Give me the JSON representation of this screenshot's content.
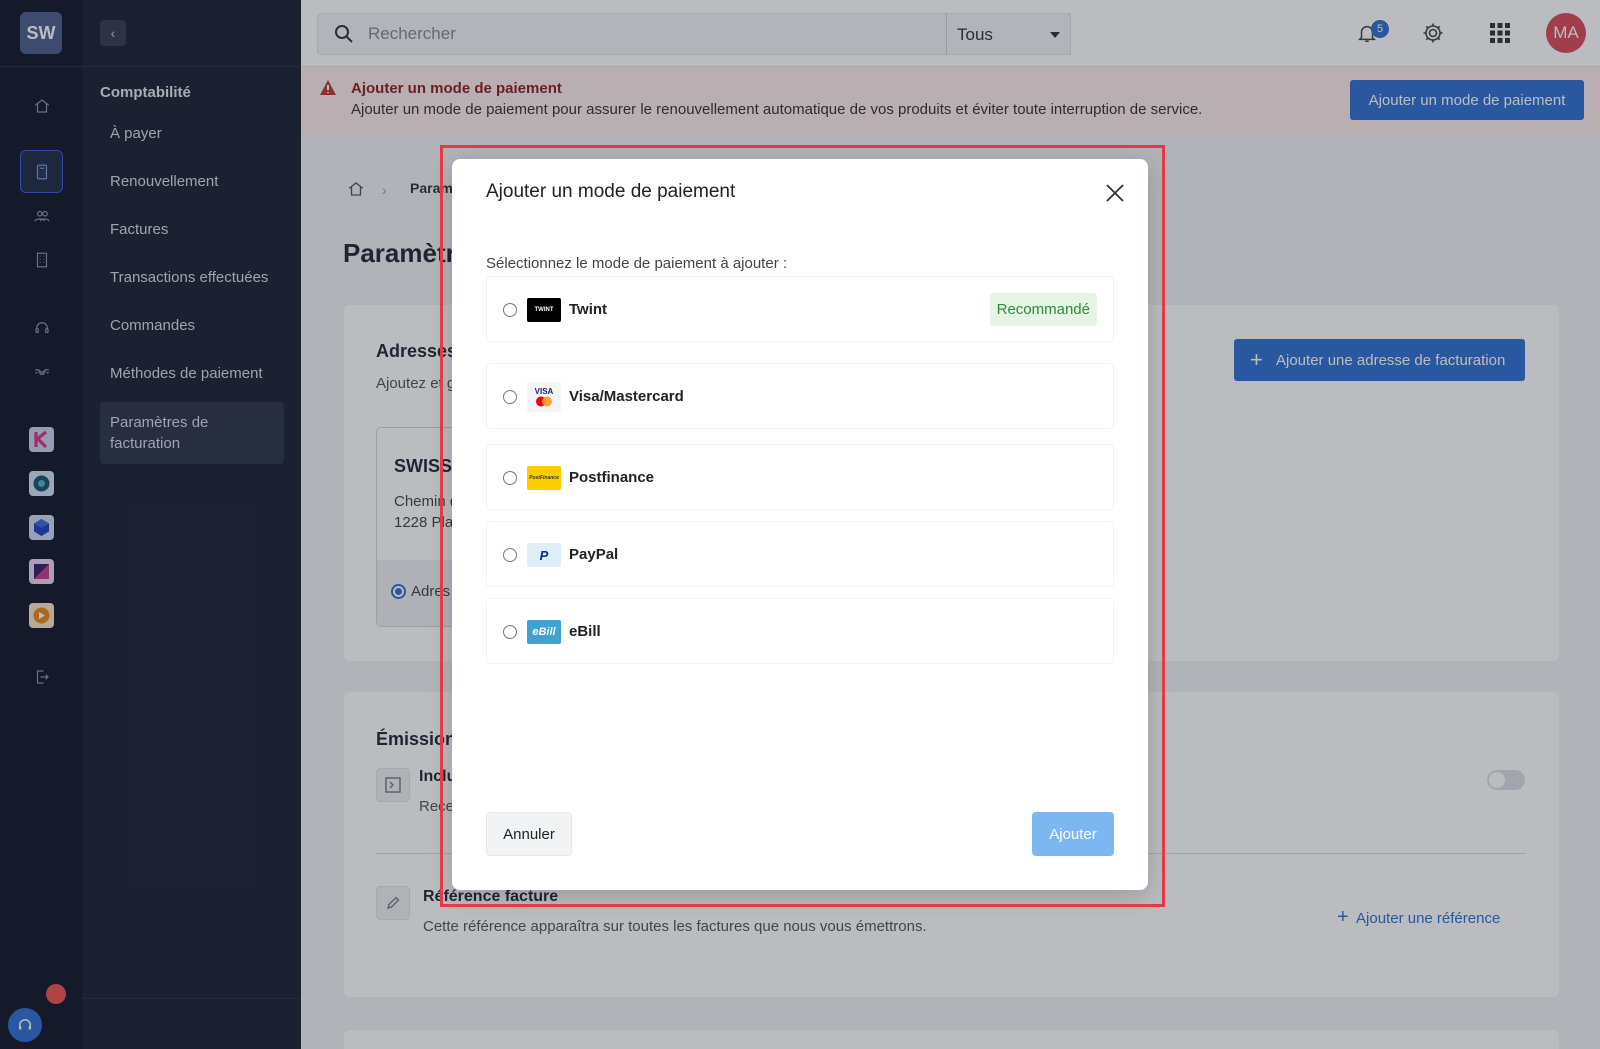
{
  "app": {
    "logo_text": "SW"
  },
  "rail": {
    "icons": [
      "home-icon",
      "calculator-icon",
      "users-icon",
      "building-icon",
      "headset-icon",
      "handshake-icon"
    ],
    "apps": [
      "app-k",
      "app-swirl",
      "app-cube",
      "app-square",
      "app-orange"
    ],
    "logout_icon": "logout-icon"
  },
  "subnav": {
    "collapse_glyph": "‹",
    "section": "Comptabilité",
    "items": [
      {
        "label": "À payer"
      },
      {
        "label": "Renouvellement"
      },
      {
        "label": "Factures"
      },
      {
        "label": "Transactions effectuées"
      },
      {
        "label": "Commandes"
      },
      {
        "label": "Méthodes de paiement"
      },
      {
        "label": "Paramètres de facturation"
      }
    ]
  },
  "topbar": {
    "search_placeholder": "Rechercher",
    "scope": "Tous",
    "notification_count": "5",
    "avatar": "MA"
  },
  "alert": {
    "title": "Ajouter un mode de paiement",
    "message": "Ajouter un mode de paiement pour assurer le renouvellement automatique de vos produits et éviter toute interruption de service.",
    "button": "Ajouter un mode de paiement"
  },
  "page": {
    "breadcrumb_current": "Paramètres",
    "title": "Paramètres",
    "address_section": {
      "title": "Adresses",
      "subtitle": "Ajoutez et gérez",
      "card_name": "SWISS",
      "card_line1": "Chemin d",
      "card_line2": "1228 Pla",
      "card_radio_label": "Adres",
      "add_button": "Ajouter une adresse de facturation"
    },
    "emission_section": {
      "title": "Émission",
      "include_title": "Inclu",
      "include_sub": "Rece",
      "reference_title": "Référence facture",
      "reference_sub": "Cette référence apparaîtra sur toutes les factures que nous vous émettrons.",
      "add_reference": "Ajouter une référence"
    }
  },
  "modal": {
    "title": "Ajouter un mode de paiement",
    "subtitle": "Sélectionnez le mode de paiement à ajouter :",
    "options": [
      {
        "label": "Twint",
        "logo_text": "TWINT",
        "badge": "Recommandé"
      },
      {
        "label": "Visa/Mastercard",
        "logo_text": "VISA"
      },
      {
        "label": "Postfinance",
        "logo_text": "PostFinance"
      },
      {
        "label": "PayPal",
        "logo_text": "P"
      },
      {
        "label": "eBill",
        "logo_text": "eBill"
      }
    ],
    "cancel": "Annuler",
    "submit": "Ajouter"
  },
  "colors": {
    "accent": "#2f6fd1",
    "alert_bg": "#fdecec",
    "highlight": "#e53946",
    "recommended": "#2e8b3a"
  }
}
